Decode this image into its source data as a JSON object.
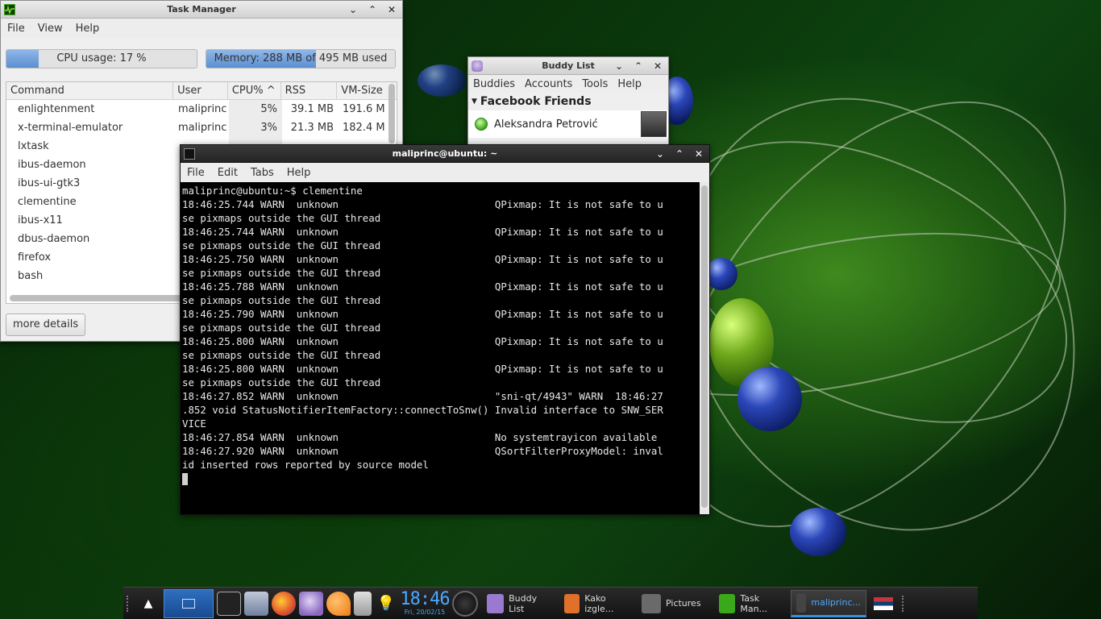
{
  "taskmgr": {
    "title": "Task Manager",
    "menu": [
      "File",
      "View",
      "Help"
    ],
    "cpu_label": "CPU usage: 17 %",
    "cpu_fraction": 0.17,
    "mem_label": "Memory: 288 MB of 495 MB used",
    "mem_fraction": 0.58,
    "columns": [
      "Command",
      "User",
      "CPU% ^",
      "RSS",
      "VM-Size"
    ],
    "rows": [
      {
        "cmd": "enlightenment",
        "user": "maliprinc",
        "cpu": "5%",
        "rss": "39.1 MB",
        "vm": "191.6 M"
      },
      {
        "cmd": "x-terminal-emulator",
        "user": "maliprinc",
        "cpu": "3%",
        "rss": "21.3 MB",
        "vm": "182.4 M"
      },
      {
        "cmd": "lxtask",
        "user": "",
        "cpu": "",
        "rss": "",
        "vm": ""
      },
      {
        "cmd": "ibus-daemon",
        "user": "",
        "cpu": "",
        "rss": "",
        "vm": ""
      },
      {
        "cmd": "ibus-ui-gtk3",
        "user": "",
        "cpu": "",
        "rss": "",
        "vm": ""
      },
      {
        "cmd": "clementine",
        "user": "",
        "cpu": "",
        "rss": "",
        "vm": ""
      },
      {
        "cmd": "ibus-x11",
        "user": "",
        "cpu": "",
        "rss": "",
        "vm": ""
      },
      {
        "cmd": "dbus-daemon",
        "user": "",
        "cpu": "",
        "rss": "",
        "vm": ""
      },
      {
        "cmd": "firefox",
        "user": "",
        "cpu": "",
        "rss": "",
        "vm": ""
      },
      {
        "cmd": "bash",
        "user": "",
        "cpu": "",
        "rss": "",
        "vm": ""
      }
    ],
    "more_details": "more details"
  },
  "buddy": {
    "title": "Buddy List",
    "menu": [
      "Buddies",
      "Accounts",
      "Tools",
      "Help"
    ],
    "group": "Facebook Friends",
    "contact": "Aleksandra Petrović"
  },
  "terminal": {
    "title": "maliprinc@ubuntu: ~",
    "menu": [
      "File",
      "Edit",
      "Tabs",
      "Help"
    ],
    "lines": [
      "maliprinc@ubuntu:~$ clementine",
      "18:46:25.744 WARN  unknown                          QPixmap: It is not safe to u",
      "se pixmaps outside the GUI thread",
      "18:46:25.744 WARN  unknown                          QPixmap: It is not safe to u",
      "se pixmaps outside the GUI thread",
      "18:46:25.750 WARN  unknown                          QPixmap: It is not safe to u",
      "se pixmaps outside the GUI thread",
      "18:46:25.788 WARN  unknown                          QPixmap: It is not safe to u",
      "se pixmaps outside the GUI thread",
      "18:46:25.790 WARN  unknown                          QPixmap: It is not safe to u",
      "se pixmaps outside the GUI thread",
      "18:46:25.800 WARN  unknown                          QPixmap: It is not safe to u",
      "se pixmaps outside the GUI thread",
      "18:46:25.800 WARN  unknown                          QPixmap: It is not safe to u",
      "se pixmaps outside the GUI thread",
      "18:46:27.852 WARN  unknown                          \"sni-qt/4943\" WARN  18:46:27",
      ".852 void StatusNotifierItemFactory::connectToSnw() Invalid interface to SNW_SER",
      "VICE",
      "18:46:27.854 WARN  unknown                          No systemtrayicon available",
      "18:46:27.920 WARN  unknown                          QSortFilterProxyModel: inval",
      "id inserted rows reported by source model"
    ]
  },
  "taskbar": {
    "clock_time": "18:46",
    "clock_date": "Fri, 20/02/15",
    "tasks": [
      {
        "label": "Buddy List",
        "icon": "pidgin-icon",
        "color": "#9a7ad0"
      },
      {
        "label": "Kako izgle...",
        "icon": "firefox-icon",
        "color": "#e0702a"
      },
      {
        "label": "Pictures",
        "icon": "folder-icon",
        "color": "#6a6a6a"
      },
      {
        "label": "Task Man...",
        "icon": "task-manager-icon",
        "color": "#3aa81a"
      },
      {
        "label": "maliprinc...",
        "icon": "terminal-icon",
        "color": "#444444"
      }
    ]
  },
  "colors": {
    "accent": "#3a8fe0",
    "desktop_green": "#1f5a12"
  }
}
